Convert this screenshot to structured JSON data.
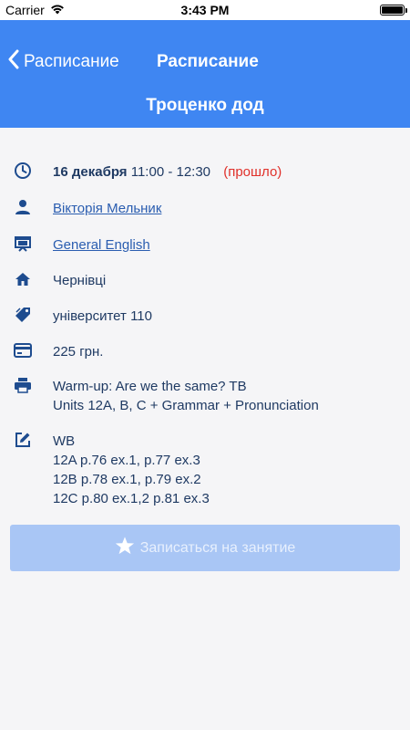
{
  "status_bar": {
    "carrier": "Carrier",
    "time": "3:43 PM"
  },
  "nav": {
    "back_label": "Расписание",
    "title": "Расписание",
    "subtitle": "Троценко дод"
  },
  "details": {
    "date": "16 декабря",
    "time_range": "11:00 - 12:30",
    "status": "(прошло)",
    "teacher": "Вікторія Мельник",
    "course": "General English",
    "city": "Чернівці",
    "location": "університет 110",
    "price": "225 грн.",
    "program_line1": "Warm-up: Are we the same? TB",
    "program_line2": "Units 12A, B, C + Grammar + Pronunciation",
    "homework_line1": "WB",
    "homework_line2": "12A p.76 ex.1, p.77 ex.3",
    "homework_line3": "12B p.78 ex.1, p.79 ex.2",
    "homework_line4": "12C p.80 ex.1,2 p.81 ex.3"
  },
  "signup_button": {
    "label": "Записаться на занятие"
  },
  "colors": {
    "accent": "#3f86f2",
    "icon": "#1e4c8f",
    "text": "#1f3a63",
    "past": "#e0302a",
    "button_disabled": "#a9c6f5"
  },
  "icons": [
    "clock-icon",
    "person-icon",
    "presentation-icon",
    "home-icon",
    "tag-icon",
    "credit-card-icon",
    "printer-icon",
    "edit-icon",
    "star-icon",
    "chevron-left-icon",
    "wifi-icon",
    "battery-icon"
  ]
}
